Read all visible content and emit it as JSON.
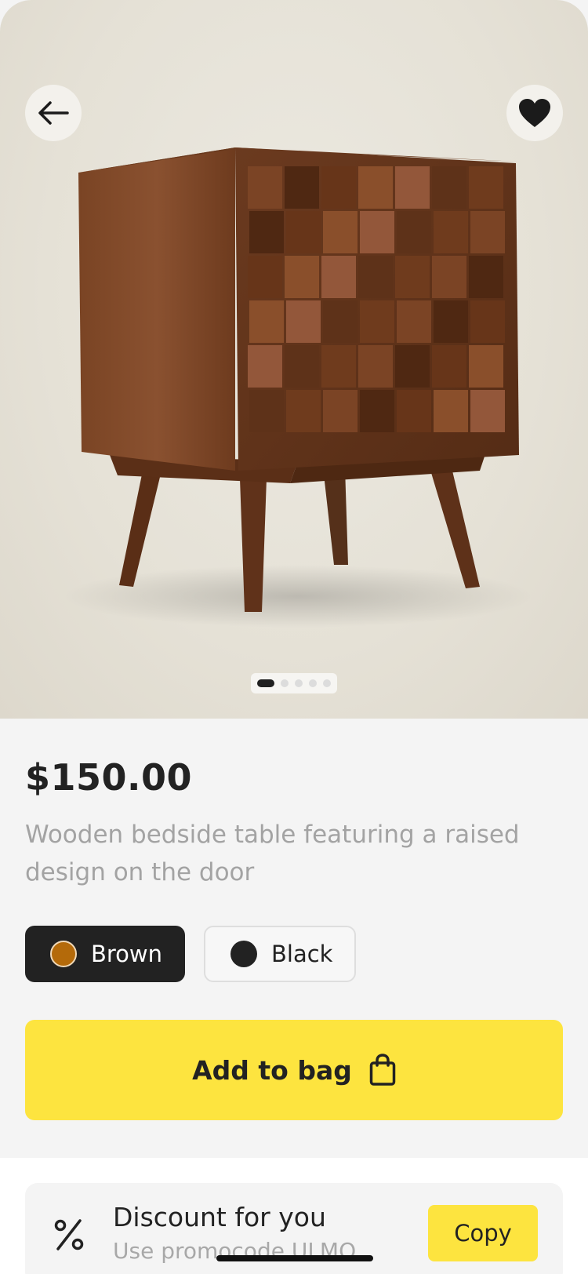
{
  "product": {
    "image_alt": "Wooden bedside table",
    "pager": {
      "count": 5,
      "active_index": 0
    },
    "price": "$150.00",
    "description": "Wooden bedside table featuring a raised design on the door",
    "colors": [
      {
        "label": "Brown",
        "swatch": "#b46a0a",
        "selected": true
      },
      {
        "label": "Black",
        "swatch": "#222222",
        "selected": false
      }
    ],
    "add_to_bag_label": "Add to bag"
  },
  "discount": {
    "title": "Discount for you",
    "subtitle": "Use promocode ULMO",
    "copy_label": "Copy"
  },
  "icons": {
    "back": "arrow-left-icon",
    "favorite": "heart-icon",
    "bag": "shopping-bag-icon",
    "percent": "percent-icon"
  },
  "colors": {
    "accent": "#fde43f",
    "dark": "#222222",
    "muted_text": "#a3a3a3"
  }
}
